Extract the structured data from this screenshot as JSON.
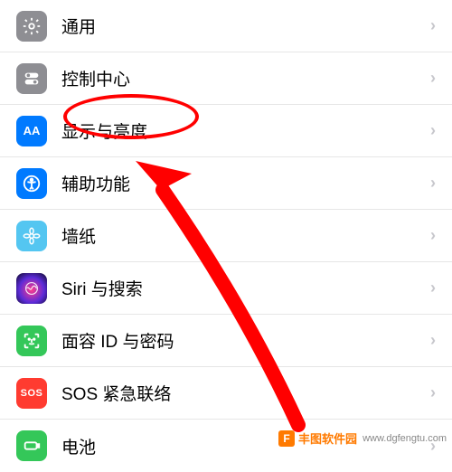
{
  "settings": {
    "rows": [
      {
        "id": "general",
        "label": "通用"
      },
      {
        "id": "control",
        "label": "控制中心"
      },
      {
        "id": "display",
        "label": "显示与亮度"
      },
      {
        "id": "accessibility",
        "label": "辅助功能"
      },
      {
        "id": "wallpaper",
        "label": "墙纸"
      },
      {
        "id": "siri",
        "label": "Siri 与搜索"
      },
      {
        "id": "faceid",
        "label": "面容 ID 与密码"
      },
      {
        "id": "sos",
        "label": "SOS 紧急联络"
      },
      {
        "id": "battery",
        "label": "电池"
      }
    ]
  },
  "icon_text": {
    "display": "AA",
    "sos": "SOS"
  },
  "annotation": {
    "highlighted_row": "display",
    "circle_color": "#ff0000",
    "arrow_color": "#ff0000"
  },
  "watermark": {
    "brand": "丰图软件园",
    "url": "www.dgfengtu.com",
    "logo_letter": "F"
  }
}
